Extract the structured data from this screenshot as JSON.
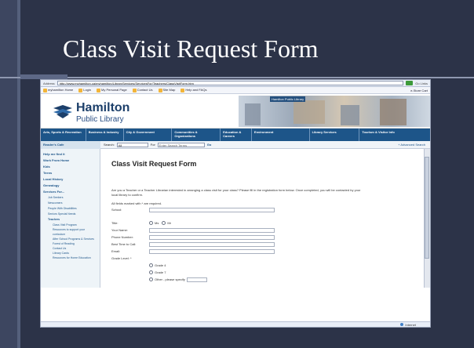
{
  "slide": {
    "title": "Class Visit Request Form"
  },
  "browser": {
    "address_label": "Address",
    "url": "http://www.myhamilton.ca/myhamilton/LibraryServices/ServicesFor/Teachers/ClassVisitForm.htm",
    "address_right": "Go  Links",
    "links": [
      "myhamilton Home",
      "Login",
      "My Personal Page",
      "Contact Us",
      "Site Map",
      "Help and FAQs"
    ],
    "links_right": "e-Store  Cart"
  },
  "site": {
    "logo_line1": "Hamilton",
    "logo_line2": "Public Library",
    "banner_text": "Hamilton Public Library",
    "nav": [
      "Arts, Sports & Recreation",
      "Business & Industry",
      "City & Government",
      "Communities & Organizations",
      "Education & Careers",
      "Environment",
      "Library Services",
      "Tourism & Visitor Info"
    ],
    "side_heading": "Reader's Cafe",
    "search_label": "Search:",
    "search_value": "All",
    "search_for": "For",
    "search_placeholder": "Enter Search Terms",
    "search_go": "Go",
    "advanced": "+ Advanced Search"
  },
  "sidebar": {
    "items": [
      "Help me find it",
      "Work From Home",
      "Kids",
      "Teens",
      "Local History",
      "Genealogy",
      "Services For..."
    ],
    "sub_items": [
      "Job Seekers",
      "Newcomers",
      "People With Disabilities",
      "Seniors Special Needs"
    ],
    "teachers": "Teachers",
    "teacher_items": [
      "Class Visit Program",
      "Resources to support your curriculum",
      "After School Programs & Services",
      "Forest of Reading",
      "Contact Us",
      "Library Cards",
      "Resources for Home Education"
    ]
  },
  "form": {
    "title": "Class Visit Request Form",
    "intro": "Are you a Teacher or a Teacher Librarian interested in arranging a class visit for your class? Please fill in the registration form below. Once completed, you will be contacted by your local library to confirm.",
    "required_note": "All fields marked with * are required.",
    "school_label": "School:",
    "title_label": "Title:",
    "title_opt1": "Ms",
    "title_opt2": "Mr",
    "name_label": "Your Name:",
    "phone_label": "Phone Number:",
    "best_time_label": "Best Time to Call:",
    "email_label": "Email:",
    "grade_label": "Grade Level: *",
    "grade_opts": [
      "Grade 4",
      "Grade 7",
      "Other - please specify"
    ]
  },
  "status": {
    "zone": "Internet"
  }
}
